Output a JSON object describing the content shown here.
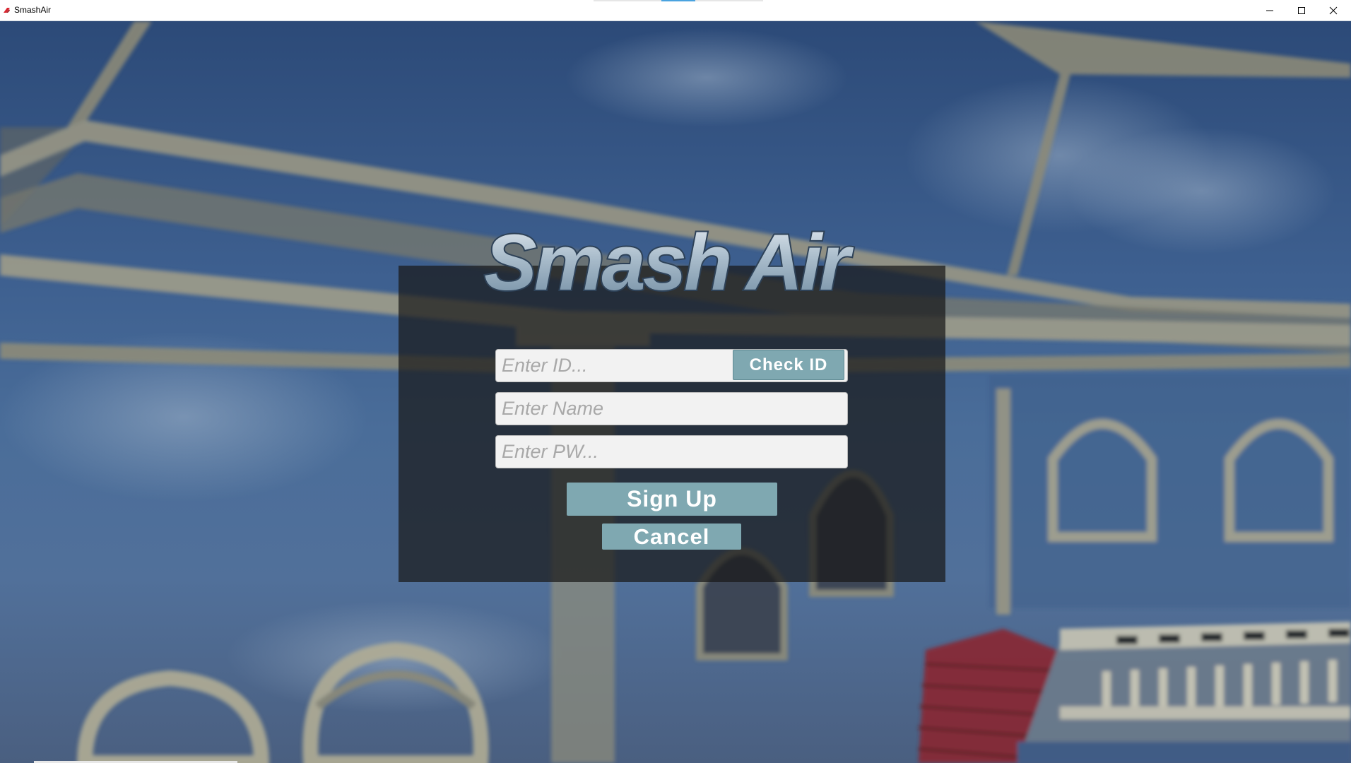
{
  "window": {
    "title": "SmashAir",
    "icon": "smashair-app-icon",
    "controls": [
      "minimize-icon",
      "maximize-icon",
      "close-icon"
    ]
  },
  "logo": {
    "text": "Smash Air"
  },
  "form": {
    "id_placeholder": "Enter ID...",
    "check_id_label": "Check ID",
    "name_placeholder": "Enter Name",
    "pw_placeholder": "Enter PW...",
    "signup_label": "Sign Up",
    "cancel_label": "Cancel"
  },
  "colors": {
    "button": "#7fa8b1",
    "button_text": "#ffffff",
    "field_bg": "#f2f2f2",
    "placeholder": "#a8a8a8",
    "panel": "rgba(25,25,25,0.72)"
  }
}
